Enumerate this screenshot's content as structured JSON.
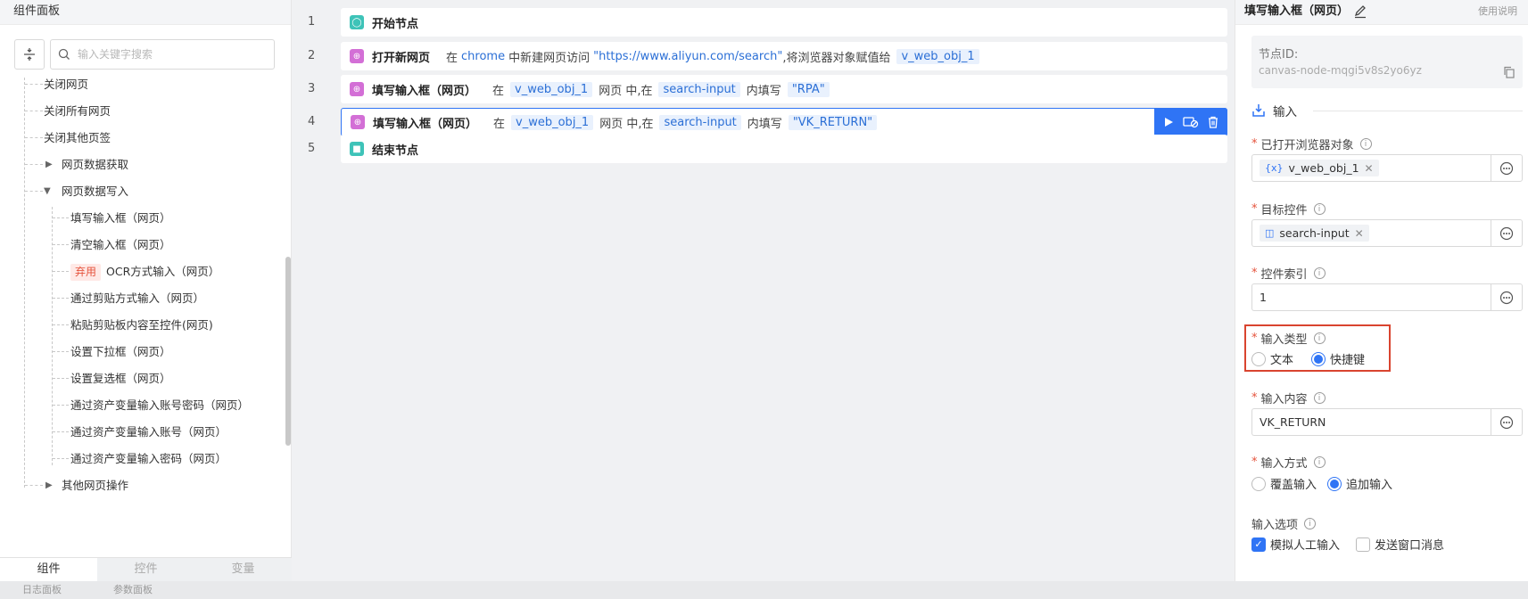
{
  "left_panel": {
    "title": "组件面板",
    "search_placeholder": "输入关键字搜索",
    "tree": [
      {
        "label": "关闭网页"
      },
      {
        "label": "关闭所有网页"
      },
      {
        "label": "关闭其他页签"
      },
      {
        "label": "网页数据获取"
      },
      {
        "label": "网页数据写入"
      },
      {
        "label": "填写输入框（网页）"
      },
      {
        "label": "清空输入框（网页）"
      },
      {
        "label": "OCR方式输入（网页）",
        "badge": "弃用"
      },
      {
        "label": "通过剪贴方式输入（网页）"
      },
      {
        "label": "粘贴剪贴板内容至控件(网页)"
      },
      {
        "label": "设置下拉框（网页）"
      },
      {
        "label": "设置复选框（网页）"
      },
      {
        "label": "通过资产变量输入账号密码（网页）"
      },
      {
        "label": "通过资产变量输入账号（网页）"
      },
      {
        "label": "通过资产变量输入密码（网页）"
      },
      {
        "label": "其他网页操作"
      }
    ],
    "tabs": [
      "组件",
      "控件",
      "变量"
    ],
    "active_tab": "组件"
  },
  "status_bar": {
    "log_panel": "日志面板",
    "param_panel": "参数面板"
  },
  "flow": {
    "rows": [
      {
        "num": "1",
        "title": "开始节点"
      },
      {
        "num": "2",
        "title": "打开新网页",
        "p1": "在",
        "browser": "chrome",
        "p2": "中新建网页访问",
        "url": "\"https://www.aliyun.com/search\"",
        "p3": ",将浏览器对象赋值给",
        "var": "v_web_obj_1"
      },
      {
        "num": "3",
        "title": "填写输入框（网页）",
        "p1": "在",
        "var": "v_web_obj_1",
        "p2": "网页 中,在",
        "ctrl": "search-input",
        "p3": "内填写",
        "value": "\"RPA\""
      },
      {
        "num": "4",
        "title": "填写输入框（网页）",
        "p1": "在",
        "var": "v_web_obj_1",
        "p2": "网页 中,在",
        "ctrl": "search-input",
        "p3": "内填写",
        "value": "\"VK_RETURN\""
      },
      {
        "num": "5",
        "title": "结束节点"
      }
    ]
  },
  "right_panel": {
    "title": "填写输入框（网页）",
    "help": "使用说明",
    "node_id_label": "节点ID:",
    "node_id": "canvas-node-mqgi5v8s2yo6yz",
    "section_input": "输入",
    "browser_obj_label": "已打开浏览器对象",
    "browser_obj_value": "v_web_obj_1",
    "target_label": "目标控件",
    "target_value": "search-input",
    "index_label": "控件索引",
    "index_value": "1",
    "input_type_label": "输入类型",
    "input_type_options": [
      "文本",
      "快捷键"
    ],
    "input_type_selected": "快捷键",
    "content_label": "输入内容",
    "content_value": "VK_RETURN",
    "method_label": "输入方式",
    "method_options": [
      "覆盖输入",
      "追加输入"
    ],
    "method_selected": "追加输入",
    "options_label": "输入选项",
    "opt_simulate": "模拟人工输入",
    "opt_simulate_checked": true,
    "opt_send_msg": "发送窗口消息",
    "opt_send_msg_checked": false,
    "accent": "#2f74f5",
    "highlight_color": "#d9442f"
  }
}
